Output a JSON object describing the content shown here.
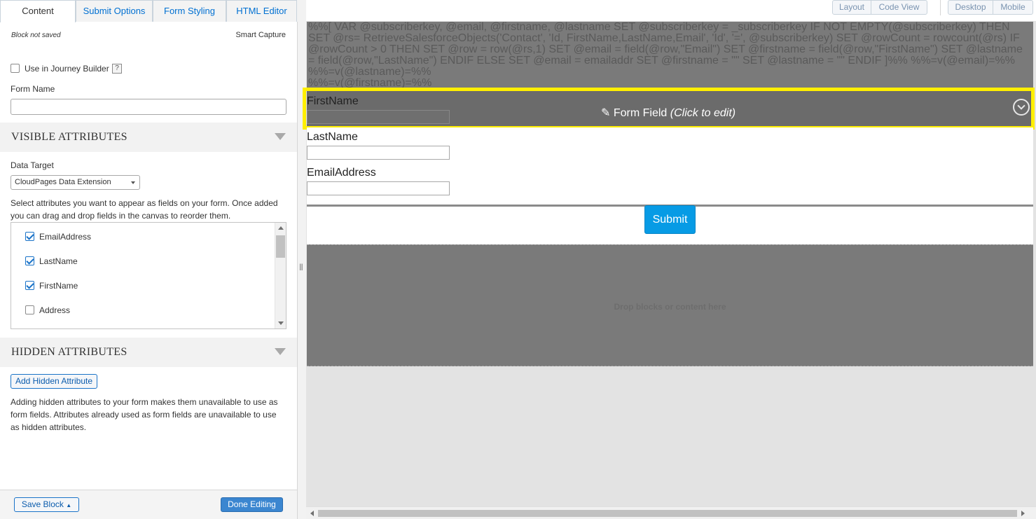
{
  "tabs": [
    "Content",
    "Submit Options",
    "Form Styling",
    "HTML Editor"
  ],
  "active_tab": "Content",
  "block_status": "Block not saved",
  "block_type": "Smart Capture",
  "journey_builder": {
    "label": "Use in Journey Builder",
    "checked": false,
    "help": "?"
  },
  "form_name": {
    "label": "Form Name",
    "value": ""
  },
  "visible_attributes": {
    "title": "VISIBLE ATTRIBUTES",
    "data_target_label": "Data Target",
    "data_target_value": "CloudPages Data Extension",
    "description": "Select attributes you want to appear as fields on your form. Once added you can drag and drop fields in the canvas to reorder them.",
    "items": [
      {
        "label": "EmailAddress",
        "checked": true
      },
      {
        "label": "LastName",
        "checked": true
      },
      {
        "label": "FirstName",
        "checked": true
      },
      {
        "label": "Address",
        "checked": false
      }
    ]
  },
  "hidden_attributes": {
    "title": "HIDDEN ATTRIBUTES",
    "add_button": "Add Hidden Attribute",
    "description": "Adding hidden attributes to your form makes them unavailable to use as form fields. Attributes already used as form fields are unavailable to use as hidden attributes."
  },
  "footer": {
    "save": "Save Block",
    "done": "Done Editing"
  },
  "view_buttons": {
    "layout": "Layout",
    "code": "Code View",
    "desktop": "Desktop",
    "mobile": "Mobile"
  },
  "ampscript": "%%[ VAR @subscriberkey, @email, @firstname, @lastname SET @subscriberkey = _subscriberkey IF NOT EMPTY(@subscriberkey) THEN SET @rs= RetrieveSalesforceObjects('Contact', 'Id, FirstName,LastName,Email', 'Id', '=', @subscriberkey) SET @rowCount = rowcount(@rs) IF @rowCount > 0 THEN SET @row = row(@rs,1) SET @email = field(@row,\"Email\") SET @firstname = field(@row,\"FirstName\") SET @lastname = field(@row,\"LastName\") ENDIF ELSE SET @email = emailaddr SET @firstname = \"\" SET @lastname = \"\" ENDIF ]%% %%=v(@email)=%% %%=v(@lastname)=%%",
  "ampscript_tail": "%%=v(@firstname)=%%",
  "form_field_overlay": {
    "label": "Form Field",
    "hint": "(Click to edit)"
  },
  "fields": [
    "FirstName",
    "LastName",
    "EmailAddress"
  ],
  "submit": "Submit",
  "drop_text": "Drop blocks or content here"
}
